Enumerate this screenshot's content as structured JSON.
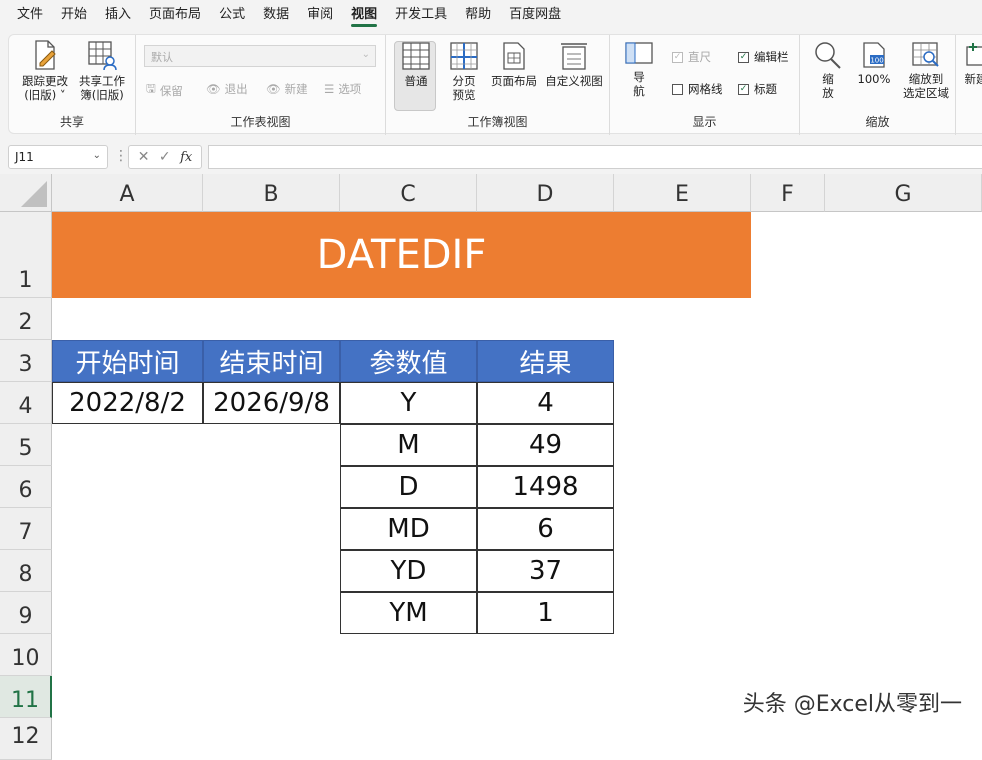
{
  "menu": {
    "tabs": [
      "文件",
      "开始",
      "插入",
      "页面布局",
      "公式",
      "数据",
      "审阅",
      "视图",
      "开发工具",
      "帮助",
      "百度网盘"
    ],
    "active": "视图"
  },
  "ribbon": {
    "share": {
      "track_changes": "跟踪更改\n(旧版)",
      "track_l1": "跟踪更改",
      "track_l2": "(旧版) ˅",
      "share_l1": "共享工作",
      "share_l2": "簿(旧版)",
      "label": "共享"
    },
    "sheet_view": {
      "dropdown": "默认",
      "keep": "保留",
      "exit": "退出",
      "new": "新建",
      "options": "选项",
      "label": "工作表视图"
    },
    "workbook_view": {
      "normal": "普通",
      "page_break_l1": "分页",
      "page_break_l2": "预览",
      "page_layout": "页面布局",
      "custom_views": "自定义视图",
      "label": "工作簿视图"
    },
    "show": {
      "nav_l1": "导",
      "nav_l2": "航",
      "ruler": "直尺",
      "formula_bar": "编辑栏",
      "gridlines": "网格线",
      "headings": "标题",
      "label": "显示"
    },
    "zoom": {
      "zoom_l1": "缩",
      "zoom_l2": "放",
      "pct100": "100%",
      "sel_l1": "缩放到",
      "sel_l2": "选定区域",
      "label": "缩放"
    },
    "new_window": "新建"
  },
  "formula_bar": {
    "name_box": "J11",
    "fx": "fx",
    "formula": ""
  },
  "sheet": {
    "columns": [
      "A",
      "B",
      "C",
      "D",
      "E",
      "F",
      "G"
    ],
    "rows": [
      "1",
      "2",
      "3",
      "4",
      "5",
      "6",
      "7",
      "8",
      "9",
      "10",
      "11",
      "12"
    ],
    "title": "DATEDIF",
    "headers": [
      "开始时间",
      "结束时间",
      "参数值",
      "结果"
    ],
    "start_date": "2022/8/2",
    "end_date": "2026/9/8",
    "params": [
      "Y",
      "M",
      "D",
      "MD",
      "YD",
      "YM"
    ],
    "results": [
      "4",
      "49",
      "1498",
      "6",
      "37",
      "1"
    ]
  },
  "watermark": "头条 @Excel从零到一",
  "colors": {
    "title_band": "#ed7d31",
    "header_fill": "#4472c4",
    "accent": "#217346"
  }
}
